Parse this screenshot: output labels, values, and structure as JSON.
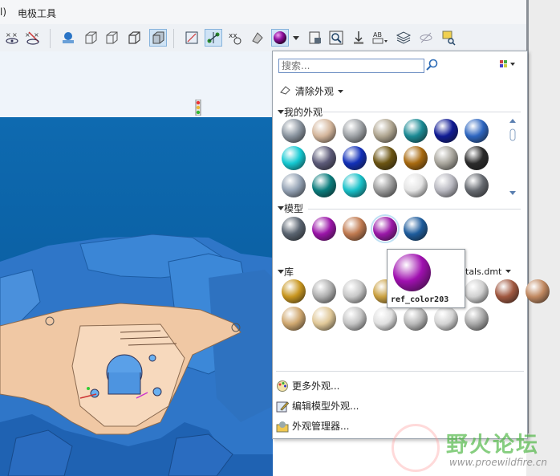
{
  "menubar": {
    "partial_item": "l)",
    "electrode_tools": "电极工具"
  },
  "toolbar": {
    "icons": [
      "hide-datum-icon",
      "unhide-datum-icon",
      "named-view-icon",
      "view-wireframe-icon",
      "view-hidden-icon",
      "view-no-hidden-icon",
      "view-shaded-icon",
      "plane-display-icon",
      "axis-display-icon",
      "point-display-icon",
      "csys-display-icon",
      "appearance-gallery-icon",
      "dropdown-arrow-icon",
      "render-icon",
      "zoom-fit-icon",
      "spin-center-icon",
      "annotation-icon",
      "layers-icon",
      "hide-icon",
      "find-icon"
    ]
  },
  "subbar": {
    "indicator_icon": "traffic-light-icon"
  },
  "panel": {
    "search_placeholder": "搜索...",
    "clear_appearance": "清除外观",
    "sections": {
      "my_appearances": "我的外观",
      "model": "模型",
      "library": "库"
    },
    "library_file": "tals.dmt",
    "tooltip_name": "ref_color203",
    "my_colors": [
      "#8b95a0",
      "#d4b69c",
      "#9ea2a6",
      "#b0a691",
      "#1b8a94",
      "#101b94",
      "#2e66c0",
      "#15c9d2",
      "#5c5a78",
      "#1230b8",
      "#6b5412",
      "#a86a10",
      "#a8a59c",
      "#2b2b2b",
      "#94a2b4",
      "#0a7c7c",
      "#18c0c8",
      "#9a9a9a",
      "#e4e4e4",
      "#b8b8c0",
      "#666a70"
    ],
    "model_colors": [
      "#5a6470",
      "#9a14a8",
      "#c07a50",
      "#9a18a8",
      "#1e5c9c"
    ],
    "library_colors": [
      "#c89620",
      "#b0b0b0",
      "#c8c8c8",
      "#caa040",
      "#c0c0c0",
      "#d8d8d8",
      "#d0d0d0",
      "#a05840",
      "#c08860",
      "#d0a870",
      "#e0c898",
      "#c4c4c4",
      "#e0e0e0",
      "#b8b8b8",
      "#d4d4d4",
      "#a8a8a8"
    ],
    "tooltip_color": "#a010b0",
    "commands": {
      "more": "更多外观...",
      "edit_model": "编辑模型外观...",
      "manager": "外观管理器..."
    }
  },
  "watermark": {
    "title": "野火论坛",
    "url": "www.proewildfire.cn"
  }
}
